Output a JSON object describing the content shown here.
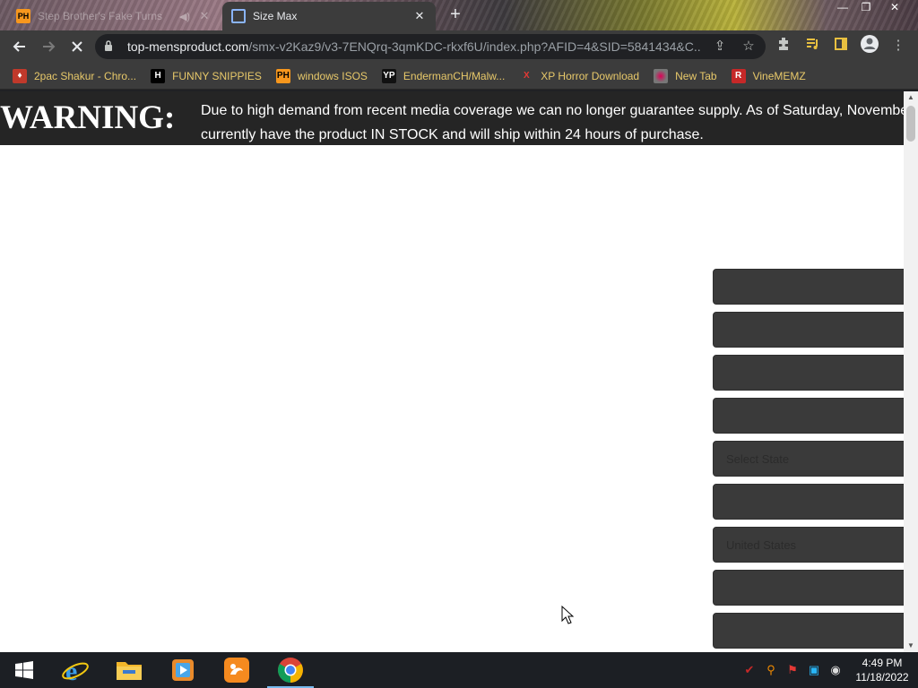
{
  "browser": {
    "tabs": [
      {
        "title": "Step Brother's Fake Turns",
        "state": "inactive",
        "favicon": "ph-favicon-icon"
      },
      {
        "title": "Size Max",
        "state": "active",
        "favicon": "globe-favicon-icon"
      }
    ],
    "new_tab_label": "+",
    "address": {
      "host": "top-mensproduct.com",
      "path": "/smx-v2Kaz9/v3-7ENQrq-3qmKDC-rkxf6U/index.php?AFID=4&SID=5841434&C..."
    },
    "bookmarks": [
      {
        "label": "2pac Shakur - Chro...",
        "icon": "2pac-icon"
      },
      {
        "label": "FUNNY SNIPPIES",
        "icon": "h-icon"
      },
      {
        "label": "windows ISOS",
        "icon": "ph-icon"
      },
      {
        "label": "EndermanCH/Malw...",
        "icon": "yp-icon"
      },
      {
        "label": "XP Horror Download",
        "icon": "x-icon"
      },
      {
        "label": "New Tab",
        "icon": "newtab-icon"
      },
      {
        "label": "VineMEMZ",
        "icon": "r-icon"
      }
    ]
  },
  "page": {
    "warning_label": "WARNING:",
    "warning_line1": "Due to high demand from recent media coverage we can no longer guarantee supply. As of Saturday, November",
    "warning_line2": "currently have the product IN STOCK and will ship within 24 hours of purchase.",
    "form_fields": [
      {
        "value": ""
      },
      {
        "value": ""
      },
      {
        "value": ""
      },
      {
        "value": ""
      },
      {
        "value": "Select State"
      },
      {
        "value": ""
      },
      {
        "value": "United States"
      },
      {
        "value": ""
      },
      {
        "value": ""
      }
    ]
  },
  "taskbar": {
    "apps": [
      "internet-explorer-icon",
      "file-explorer-icon",
      "media-player-icon",
      "uc-browser-icon",
      "chrome-icon"
    ],
    "time": "4:49 PM",
    "date": "11/18/2022"
  },
  "colors": {
    "warning_bg": "#252525",
    "field_bg": "#3a3a3a",
    "bookmark_text": "#e8c96a"
  }
}
